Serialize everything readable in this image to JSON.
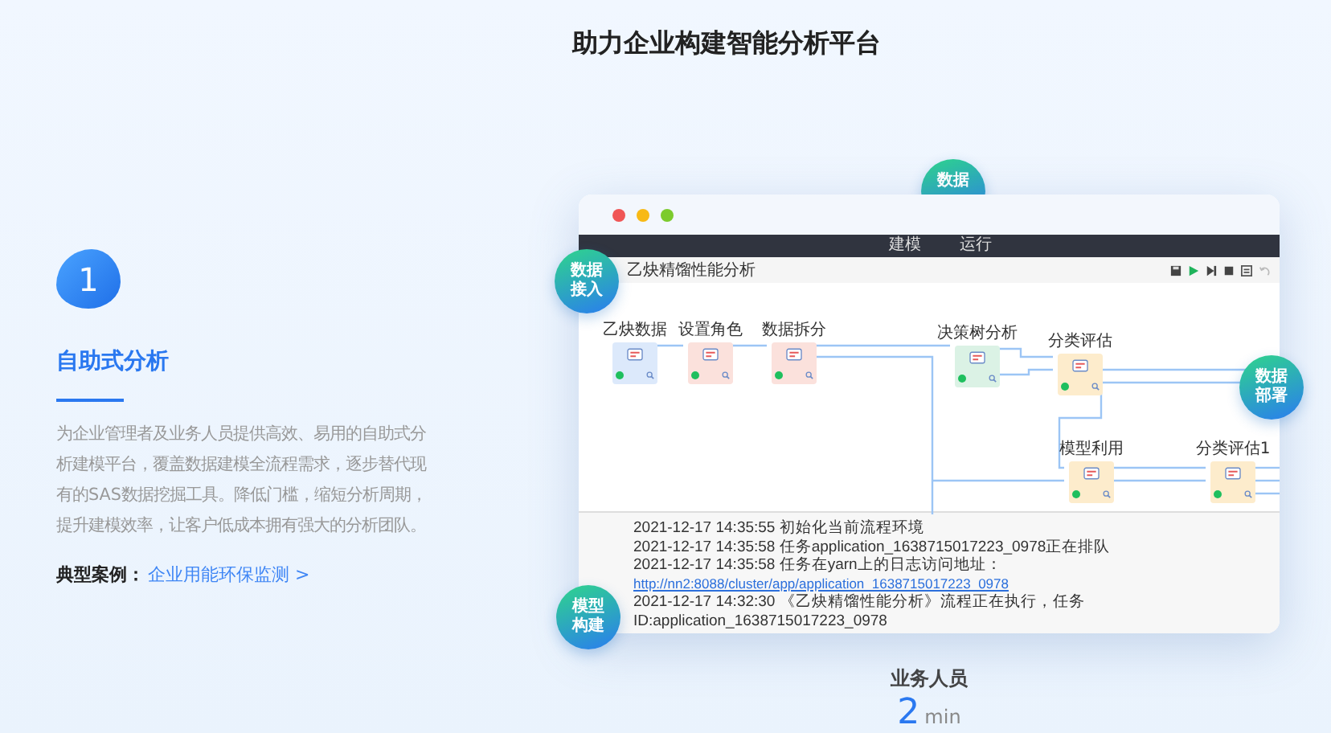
{
  "title": "助力企业构建智能分析平台",
  "feature": {
    "number": "1",
    "heading": "自助式分析",
    "description": "为企业管理者及业务人员提供高效、易用的自助式分析建模平台，覆盖数据建模全流程需求，逐步替代现有的SAS数据挖掘工具。降低门槛，缩短分析周期，提升建模效率，让客户低成本拥有强大的分析团队。",
    "case_label": "典型案例：",
    "case_link": "企业用能环保监测 >"
  },
  "app": {
    "menu": [
      "建模",
      "运行"
    ],
    "tab": "乙炔精馏性能分析",
    "nodes": [
      {
        "label": "乙炔数据",
        "kind": "input"
      },
      {
        "label": "设置角色",
        "kind": "process"
      },
      {
        "label": "数据拆分",
        "kind": "process"
      },
      {
        "label": "决策树分析",
        "kind": "tree"
      },
      {
        "label": "分类评估",
        "kind": "eval"
      },
      {
        "label": "模型利用",
        "kind": "eval"
      },
      {
        "label": "分类评估1",
        "kind": "eval"
      }
    ],
    "logs": [
      {
        "time": "2021-12-17 14:35:55",
        "text": "初始化当前流程环境"
      },
      {
        "time": "2021-12-17 14:35:58",
        "text": "任务application_1638715017223_0978正在排队"
      },
      {
        "time": "2021-12-17 14:35:58",
        "text": "任务在yarn上的日志访问地址：",
        "link": "http://nn2:8088/cluster/app/application_1638715017223_0978"
      },
      {
        "time": "2021-12-17 14:32:30",
        "text": "《乙炔精馏性能分析》流程正在执行，任务ID:application_1638715017223_0978"
      }
    ]
  },
  "bubbles": [
    {
      "text": "数据"
    },
    {
      "text": "数据接入"
    },
    {
      "text": "数据部署"
    },
    {
      "text": "模型构建"
    }
  ],
  "stat": {
    "label": "业务人员",
    "value": "2",
    "unit": "min"
  }
}
